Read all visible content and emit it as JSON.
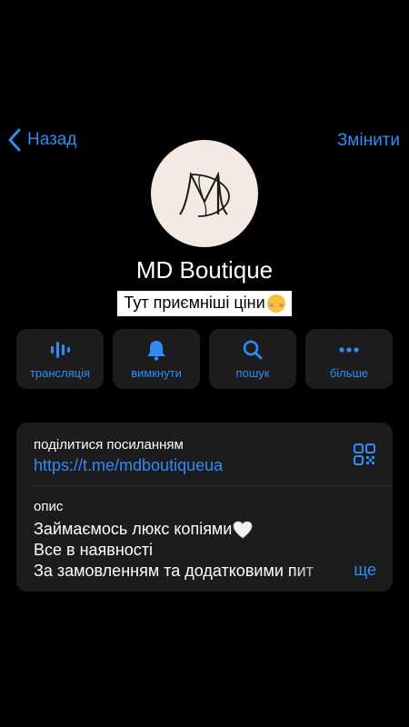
{
  "nav": {
    "back_label": "Назад",
    "edit_label": "Змінити"
  },
  "channel": {
    "name": "MD Boutique",
    "status": "Тут приємніші ціни",
    "avatar_monogram": "MD"
  },
  "actions": [
    {
      "icon": "broadcast-icon",
      "label": "трансляція"
    },
    {
      "icon": "bell-icon",
      "label": "вимкнути"
    },
    {
      "icon": "search-icon",
      "label": "пошук"
    },
    {
      "icon": "ellipsis-icon",
      "label": "більше"
    }
  ],
  "info": {
    "link_caption": "поділитися посиланням",
    "link_value": "https://t.me/mdboutiqueua",
    "description_caption": "опис",
    "description_lines": [
      "Займаємось люкс копіями",
      "Все в наявності",
      "За замовленням та додатковими пит"
    ],
    "more_label": "ще"
  },
  "colors": {
    "accent": "#2f8cf5",
    "background": "#000000",
    "card": "#1c1c1e",
    "avatar_bg": "#f4e9e3"
  }
}
